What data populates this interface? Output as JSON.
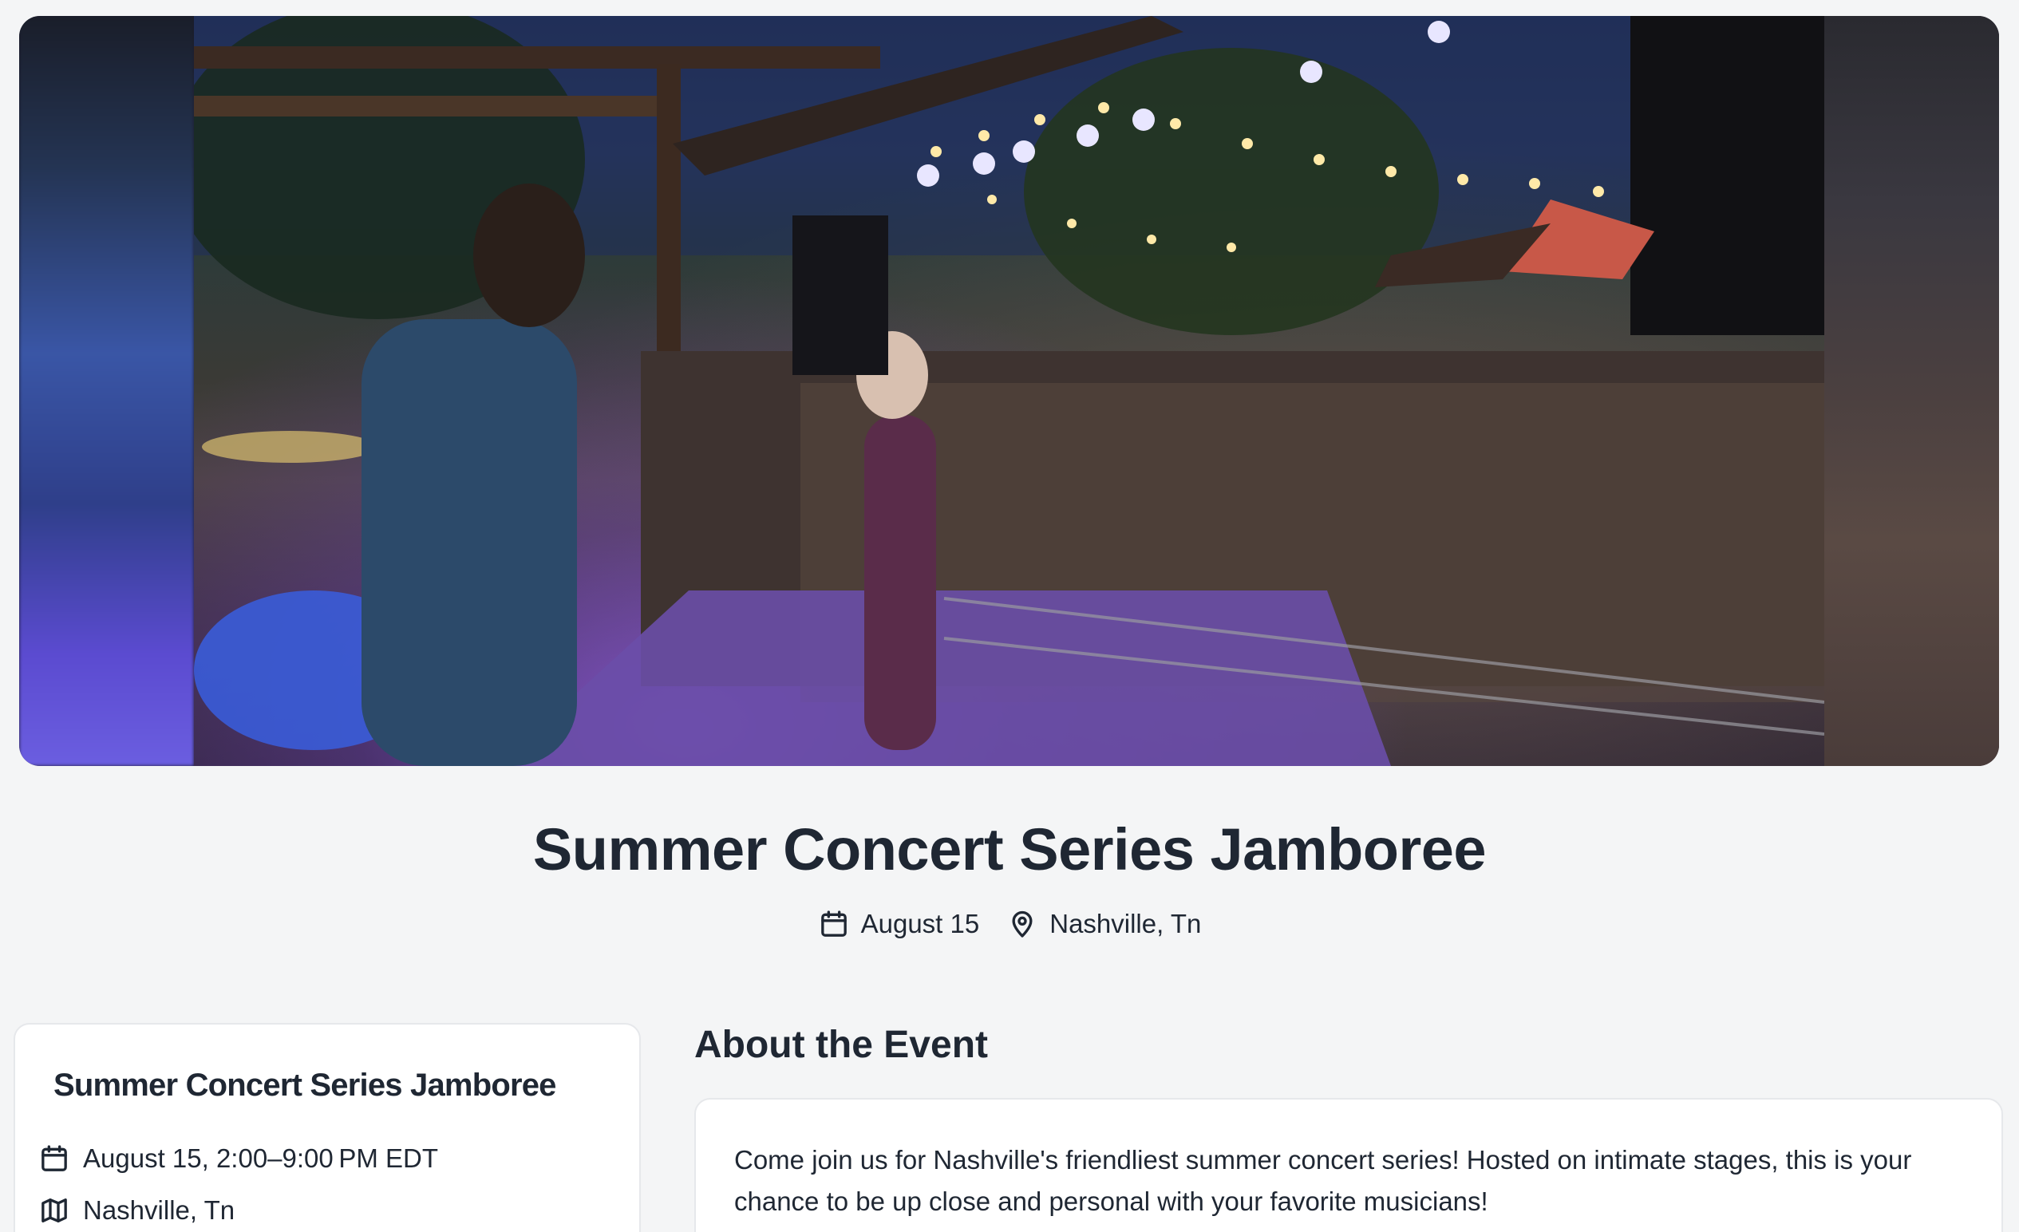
{
  "hero": {
    "image_label": "Concert stage with performers and crowd at night"
  },
  "event": {
    "title": "Summer Concert Series Jamboree",
    "date_short": "August 15",
    "location": "Nashville, Tn"
  },
  "info_card": {
    "title": "Summer Concert Series Jamboree",
    "date_time": "August 15, 2:00–9:00 PM EDT",
    "location": "Nashville, Tn"
  },
  "about": {
    "heading": "About the Event",
    "description": "Come join us for Nashville's friendliest summer concert series! Hosted on intimate stages, this is your chance to be up close and personal with your favorite musicians!"
  },
  "icons": {
    "date": "calendar-icon",
    "location": "map-pin-icon",
    "map": "map-icon"
  }
}
